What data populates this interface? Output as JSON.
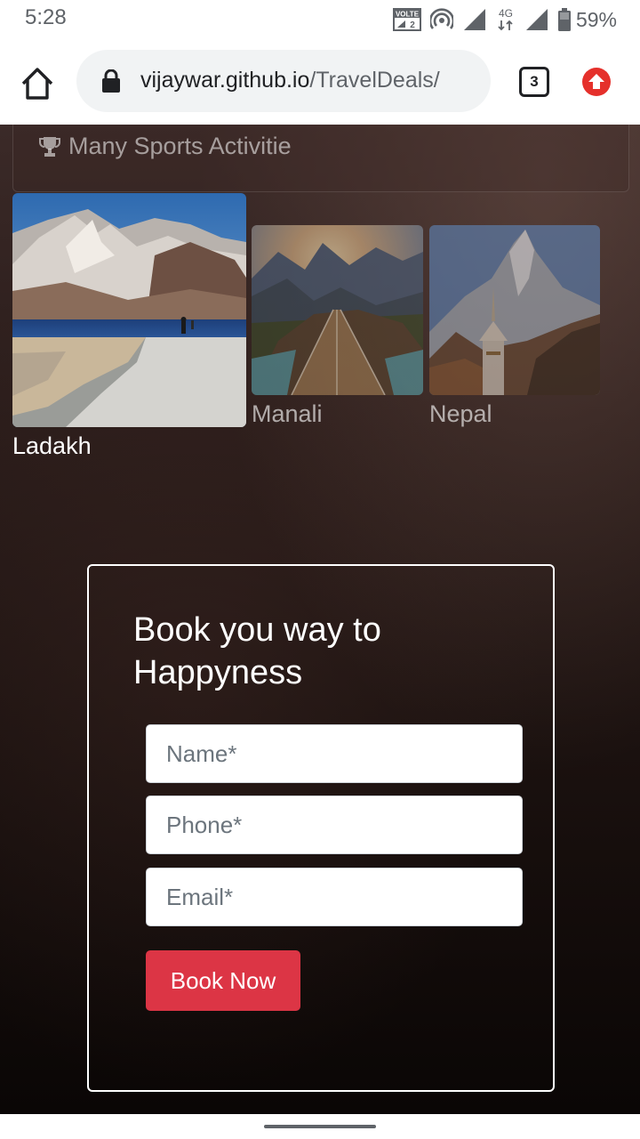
{
  "status_bar": {
    "time": "5:28",
    "volte_label": "VOLTE",
    "sim_slot": "2",
    "network_type": "4G",
    "battery": "59%",
    "icons": [
      "volte-icon",
      "hotspot-icon",
      "signal-icon",
      "signal-4g-icon",
      "battery-icon"
    ]
  },
  "browser": {
    "url_host": "vijaywar.github.io",
    "url_path": "/TravelDeals/",
    "tab_count": "3",
    "icons": [
      "home-icon",
      "lock-icon",
      "tabs-icon",
      "update-icon"
    ]
  },
  "features": {
    "item": "Many Sports Activitie",
    "icon": "trophy-icon"
  },
  "destinations": [
    {
      "name": "Ladakh"
    },
    {
      "name": "Manali"
    },
    {
      "name": "Nepal"
    }
  ],
  "booking": {
    "title": "Book you way to Happyness",
    "name_placeholder": "Name*",
    "phone_placeholder": "Phone*",
    "email_placeholder": "Email*",
    "submit_label": "Book Now"
  },
  "colors": {
    "button": "#dc3545",
    "update_icon": "#e5302b",
    "page_background": "#1c1210"
  }
}
